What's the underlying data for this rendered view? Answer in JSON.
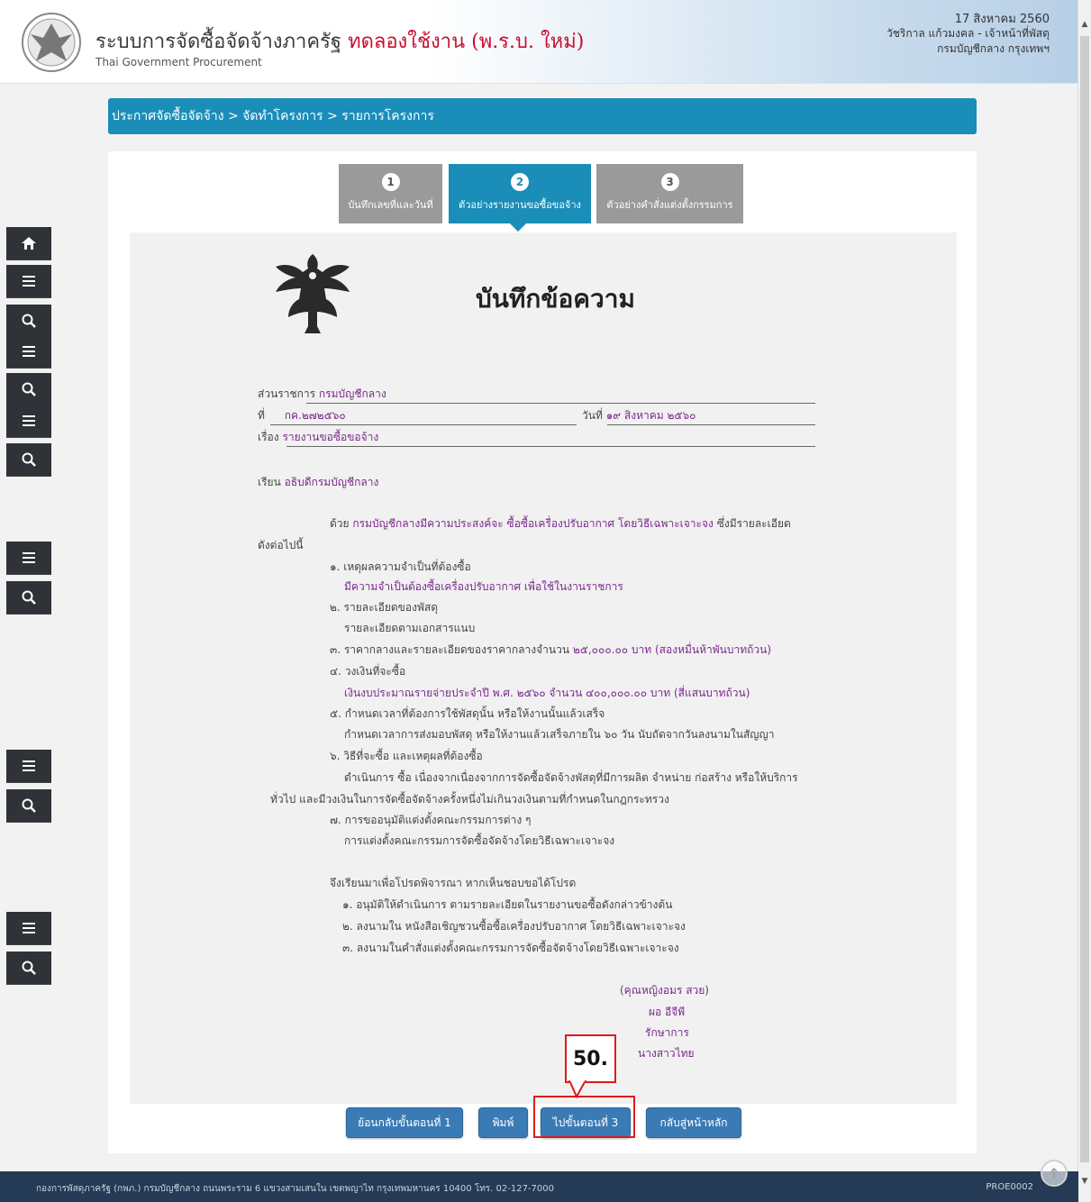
{
  "header": {
    "title_main": "ระบบการจัดซื้อจัดจ้างภาครัฐ",
    "title_trial": "ทดลองใช้งาน (พ.ร.บ. ใหม่)",
    "subtitle": "Thai Government Procurement",
    "date": "17 สิงหาคม 2560",
    "user": "วัชริกาล แก้วมงคล - เจ้าหน้าที่พัสดุ",
    "org": "กรมบัญชีกลาง กรุงเทพฯ"
  },
  "breadcrumb": "ประกาศจัดซื้อจัดจ้าง > จัดทำโครงการ > รายการโครงการ",
  "steps": [
    {
      "num": "1",
      "label": "บันทึกเลขที่และวันที่"
    },
    {
      "num": "2",
      "label": "ตัวอย่างรายงานขอซื้อขอจ้าง"
    },
    {
      "num": "3",
      "label": "ตัวอย่างคำสั่งแต่งตั้งกรรมการ"
    }
  ],
  "memo": {
    "title": "บันทึกข้อความ",
    "dept_label": "ส่วนราชการ",
    "dept_value": "กรมบัญชีกลาง",
    "no_label": "ที่",
    "no_value": "กค.๒๗๒๕๖๐",
    "date_label": "วันที่",
    "date_value": "๑๙ สิงหาคม ๒๕๖๐",
    "subject_label": "เรื่อง",
    "subject_value": "รายงานขอซื้อขอจ้าง",
    "to_label": "เรียน",
    "to_value": "อธิบดีกรมบัญชีกลาง",
    "para_prefix": "ด้วย",
    "para_value": "กรมบัญชีกลางมีความประสงค์จะ ซื้อซื้อเครื่องปรับอากาศ โดยวิธีเฉพาะเจาะจง",
    "para_suffix": "ซึ่งมีรายละเอียด",
    "para_line2": "ดังต่อไปนี้",
    "item1": "๑. เหตุผลความจำเป็นที่ต้องซื้อ",
    "item1_val": "มีความจำเป็นต้องซื้อเครื่องปรับอากาศ เพื่อใช้ในงานราชการ",
    "item2": "๒. รายละเอียดของพัสดุ",
    "item2_val": "รายละเอียดตามเอกสารแนบ",
    "item3_prefix": "๓. ราคากลางและรายละเอียดของราคากลางจำนวน",
    "item3_val": "๒๕,๐๐๐.๐๐ บาท (สองหมื่นห้าพันบาทถ้วน)",
    "item4": "๔. วงเงินที่จะซื้อ",
    "item4_val": "เงินงบประมาณรายจ่ายประจำปี พ.ศ. ๒๕๖๐ จำนวน ๔๐๐,๐๐๐.๐๐ บาท (สี่แสนบาทถ้วน)",
    "item5": "๕. กำหนดเวลาที่ต้องการใช้พัสดุนั้น หรือให้งานนั้นแล้วเสร็จ",
    "item5_val": "กำหนดเวลาการส่งมอบพัสดุ หรือให้งานแล้วเสร็จภายใน ๖๐ วัน นับถัดจากวันลงนามในสัญญา",
    "item6": "๖. วิธีที่จะซื้อ และเหตุผลที่ต้องซื้อ",
    "item6_val1": "ดำเนินการ ซื้อ เนื่องจากเนื่องจากการจัดซื้อจัดจ้างพัสดุที่มีการผลิต จำหน่าย ก่อสร้าง หรือให้บริการ",
    "item6_val2": "ทั่วไป และมีวงเงินในการจัดซื้อจัดจ้างครั้งหนึ่งไม่เกินวงเงินตามที่กำหนดในกฎกระทรวง",
    "item7": "๗. การขออนุมัติแต่งตั้งคณะกรรมการต่าง ๆ",
    "item7_val": "การแต่งตั้งคณะกรรมการจัดซื้อจัดจ้างโดยวิธีเฉพาะเจาะจง",
    "close_para": "จึงเรียนมาเพื่อโปรดพิจารณา หากเห็นชอบขอได้โปรด",
    "close1": "๑. อนุมัติให้ดำเนินการ ตามรายละเอียดในรายงานขอซื้อดังกล่าวข้างต้น",
    "close2": "๒. ลงนามใน หนังสือเชิญชวนซื้อซื้อเครื่องปรับอากาศ โดยวิธีเฉพาะเจาะจง",
    "close3": "๓. ลงนามในคำสั่งแต่งตั้งคณะกรรมการจัดซื้อจัดจ้างโดยวิธีเฉพาะเจาะจง",
    "sig_name": "(คุณหญิงอมร สวย)",
    "sig_pos1": "ผอ อีจีพี",
    "sig_pos2": "รักษาการ",
    "sig_pos3": "นางสาวไทย"
  },
  "buttons": {
    "back": "ย้อนกลับขั้นตอนที่ 1",
    "print": "พิมพ์",
    "next": "ไปขั้นตอนที่ 3",
    "home": "กลับสู่หน้าหลัก"
  },
  "callout": "50.",
  "footer": {
    "text": "กองการพัสดุภาครัฐ (กพภ.) กรมบัญชีกลาง ถนนพระราม 6 แขวงสามเสนใน เขตพญาไท กรุงเทพมหานคร 10400 โทร. 02-127-7000",
    "code": "PROE0002"
  },
  "colors": {
    "accent": "#1a8db8",
    "sidebar": "#2f3237",
    "highlight": "#e01a1a",
    "value_text": "#7a2a8c"
  }
}
